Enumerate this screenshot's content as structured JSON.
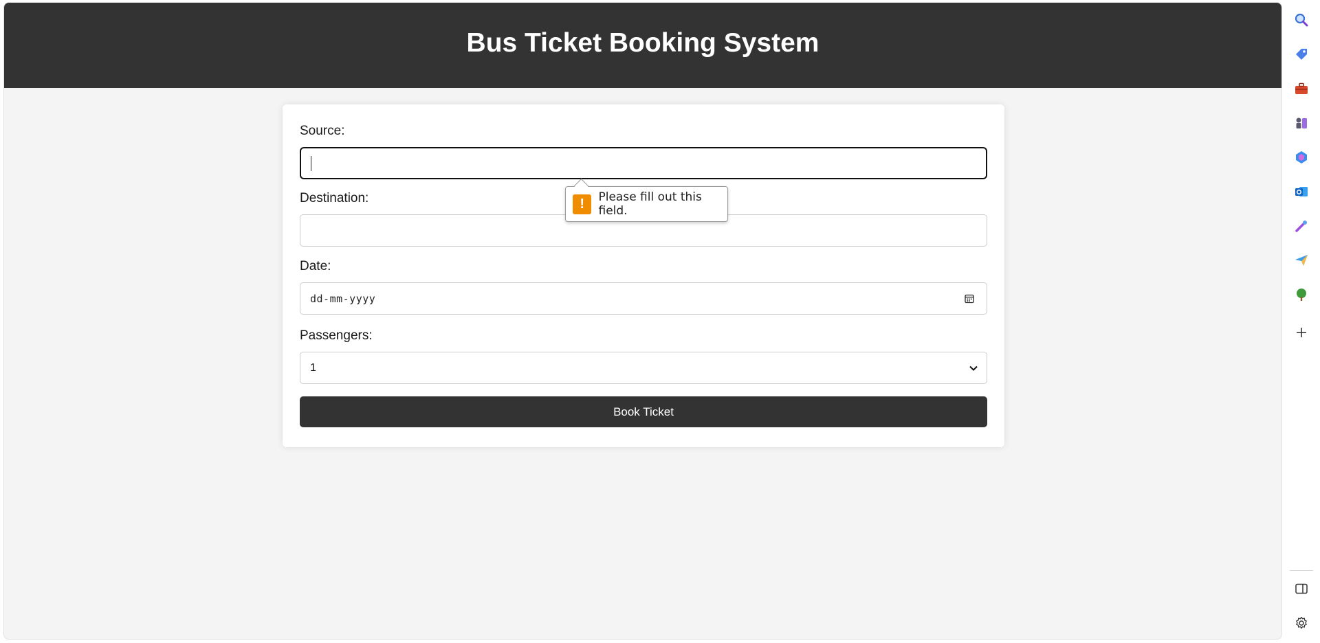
{
  "header": {
    "title": "Bus Ticket Booking System"
  },
  "form": {
    "source_label": "Source:",
    "source_value": "",
    "destination_label": "Destination:",
    "destination_value": "",
    "date_label": "Date:",
    "date_placeholder": "dd-mm-yyyy",
    "passengers_label": "Passengers:",
    "passengers_selected": "1",
    "submit_label": "Book Ticket"
  },
  "validation": {
    "message": "Please fill out this field.",
    "icon": "!"
  },
  "colors": {
    "header_bg": "#333333",
    "button_bg": "#333333",
    "warning": "#f08c00",
    "page_bg": "#f4f4f4"
  },
  "sidebar": {
    "icons": [
      "search-icon",
      "tag-icon",
      "briefcase-icon",
      "chess-icon",
      "copilot-icon",
      "outlook-icon",
      "magic-icon",
      "send-icon",
      "tree-icon",
      "add-icon",
      "panel-icon",
      "settings-icon"
    ]
  }
}
